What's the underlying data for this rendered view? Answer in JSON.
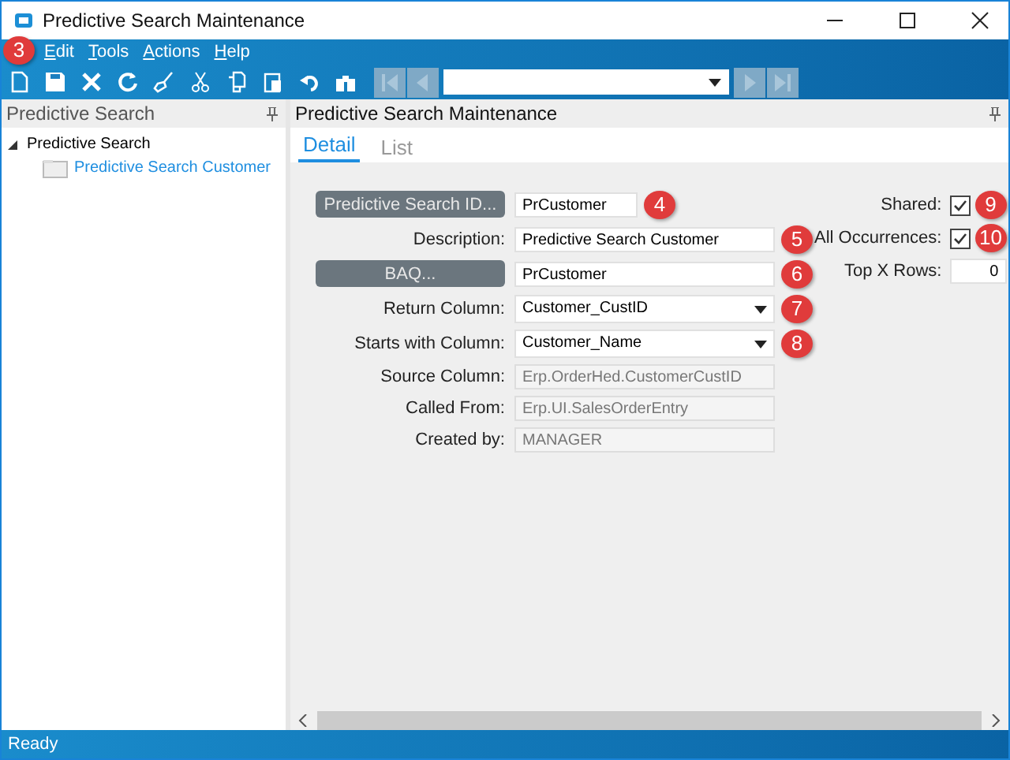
{
  "window": {
    "title": "Predictive Search Maintenance"
  },
  "menu": {
    "callout": "3",
    "items": [
      {
        "label": "Edit"
      },
      {
        "label": "Tools"
      },
      {
        "label": "Actions"
      },
      {
        "label": "Help"
      }
    ]
  },
  "left_panel": {
    "title": "Predictive Search",
    "tree": [
      {
        "label": "Predictive Search",
        "expanded": true,
        "children": [
          {
            "label": "Predictive Search Customer",
            "selected": true
          }
        ]
      }
    ]
  },
  "right_panel": {
    "title": "Predictive Search Maintenance",
    "tabs": [
      {
        "label": "Detail",
        "selected": true
      },
      {
        "label": "List",
        "selected": false
      }
    ],
    "fields": [
      {
        "kind": "button",
        "label": "Predictive Search ID...",
        "value": "PrCustomer",
        "callout": "4"
      },
      {
        "kind": "text",
        "label": "Description:",
        "value": "Predictive Search Customer",
        "callout": "5"
      },
      {
        "kind": "button",
        "label": "BAQ...",
        "value": "PrCustomer",
        "callout": "6"
      },
      {
        "kind": "dropdown",
        "label": "Return Column:",
        "value": "Customer_CustID",
        "callout": "7"
      },
      {
        "kind": "dropdown",
        "label": "Starts with Column:",
        "value": "Customer_Name",
        "callout": "8"
      },
      {
        "kind": "readonly",
        "label": "Source Column:",
        "value": "Erp.OrderHed.CustomerCustID"
      },
      {
        "kind": "readonly",
        "label": "Called From:",
        "value": "Erp.UI.SalesOrderEntry"
      },
      {
        "kind": "readonly",
        "label": "Created by:",
        "value": "MANAGER"
      }
    ],
    "options": [
      {
        "kind": "checkbox",
        "label": "Shared:",
        "checked": true,
        "callout": "9"
      },
      {
        "kind": "checkbox",
        "label": "All Occurrences:",
        "checked": true,
        "callout": "10"
      },
      {
        "kind": "number",
        "label": "Top X Rows:",
        "value": "0"
      }
    ]
  },
  "status_bar": "Ready"
}
